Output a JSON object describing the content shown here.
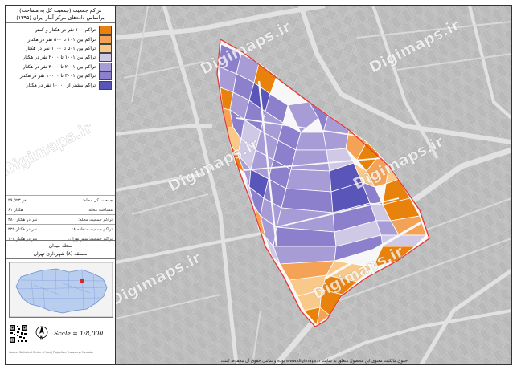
{
  "title": {
    "line1": "تراکم جمعیت (جمعیت کل به مساحت)",
    "line2": "براساس داده‌های مرکز آمار ایران (۱۳۹۵)"
  },
  "legend": [
    {
      "label": "تراکم ۱۰۰ نفر در هکتار و کمتر",
      "color": "#e8820c"
    },
    {
      "label": "تراکم بین ۱۰۱ تا ۵۰۰ نفر در هکتار",
      "color": "#f4a356"
    },
    {
      "label": "تراکم بین ۵۰۱ تا ۱۰۰۰ نفر در هکتار",
      "color": "#f9c98a"
    },
    {
      "label": "تراکم بین ۱۰۰۱ تا ۲۰۰۰ نفر در هکتار",
      "color": "#cfc9e6"
    },
    {
      "label": "تراکم بین ۲۰۰۱ تا ۳۰۰۰ نفر در هکتار",
      "color": "#a89cd6"
    },
    {
      "label": "تراکم بین ۳۰۰۱ تا ۱۰۰۰۰ نفر در هکتار",
      "color": "#8c80cc"
    },
    {
      "label": "تراکم بیشتر از ۱۰۰۰۰ نفر در هکتار",
      "color": "#5a55b8"
    }
  ],
  "stats": [
    {
      "key": "جمعیت کل محله:",
      "value": "۲۹,۵۲۳ نفر"
    },
    {
      "key": "مساحت محله:",
      "value": "۶۱ هکتار"
    },
    {
      "key": "تراکم جمعیت محله:",
      "value": "۴۸۰ نفر در هکتار"
    },
    {
      "key": "تراکم جمعیت منطقه ۸:",
      "value": "۳۳۵ نفر در هکتار"
    },
    {
      "key": "تراکم جمعیت شهر تهران:",
      "value": "۱۰۸ نفر در هکتار"
    }
  ],
  "place": {
    "neighborhood": "محله میدان",
    "district": "منطقه (۸) شهرداری تهران"
  },
  "scale": "Scale = 1:8,000",
  "footer_left": "Source: Statistical Center of Iran | Projection: Transverse Mercator",
  "copyright": "حقوق مالکیت معنوی این محصول متعلق به سایت www.digimaps.ir بوده و تمامی حقوق آن محفوظ است.",
  "watermark": "Digimaps.ir",
  "colors": {
    "zone_outline": "#e23b3b",
    "streets": "#d4d4d4",
    "background_map": "#c9c9c9"
  },
  "icons": {
    "north": "north-arrow-icon",
    "qr": "qr-code-icon"
  }
}
